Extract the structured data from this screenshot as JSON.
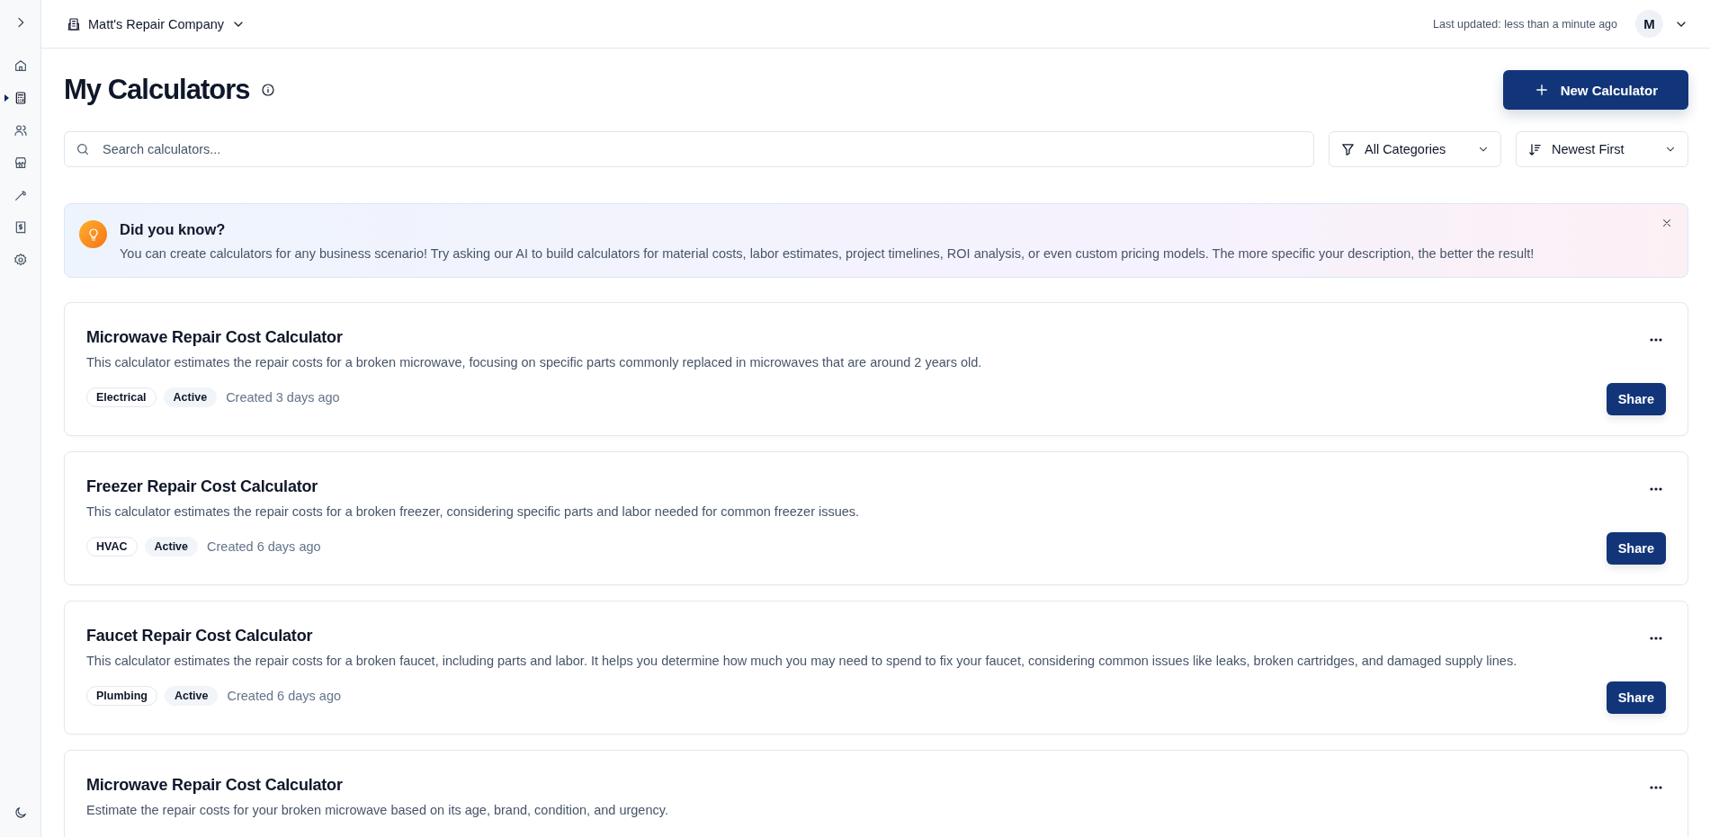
{
  "sidebar": {
    "items": [
      {
        "selected": false
      },
      {
        "selected": true
      },
      {
        "selected": false
      },
      {
        "selected": false
      },
      {
        "selected": false
      },
      {
        "selected": false
      },
      {
        "selected": false
      }
    ]
  },
  "header": {
    "company": "Matt's Repair Company",
    "last_updated": "Last updated: less than a minute ago",
    "avatar": "M"
  },
  "page": {
    "title": "My Calculators",
    "new_button": "New Calculator"
  },
  "filters": {
    "search": {
      "placeholder": "Search calculators..."
    },
    "category": "All Categories",
    "sort": "Newest First"
  },
  "tip": {
    "title": "Did you know?",
    "text": "You can create calculators for any business scenario! Try asking our AI to build calculators for material costs, labor estimates, project timelines, ROI analysis, or even custom pricing models. The more specific your description, the better the result!"
  },
  "calculators": [
    {
      "title": "Microwave Repair Cost Calculator",
      "description": "This calculator estimates the repair costs for a broken microwave, focusing on specific parts commonly replaced in microwaves that are around 2 years old.",
      "category": "Electrical",
      "status": "Active",
      "created": "Created 3 days ago",
      "share": "Share"
    },
    {
      "title": "Freezer Repair Cost Calculator",
      "description": "This calculator estimates the repair costs for a broken freezer, considering specific parts and labor needed for common freezer issues.",
      "category": "HVAC",
      "status": "Active",
      "created": "Created 6 days ago",
      "share": "Share"
    },
    {
      "title": "Faucet Repair Cost Calculator",
      "description": "This calculator estimates the repair costs for a broken faucet, including parts and labor. It helps you determine how much you may need to spend to fix your faucet, considering common issues like leaks, broken cartridges, and damaged supply lines.",
      "category": "Plumbing",
      "status": "Active",
      "created": "Created 6 days ago",
      "share": "Share"
    },
    {
      "title": "Microwave Repair Cost Calculator",
      "description": "Estimate the repair costs for your broken microwave based on its age, brand, condition, and urgency."
    }
  ]
}
